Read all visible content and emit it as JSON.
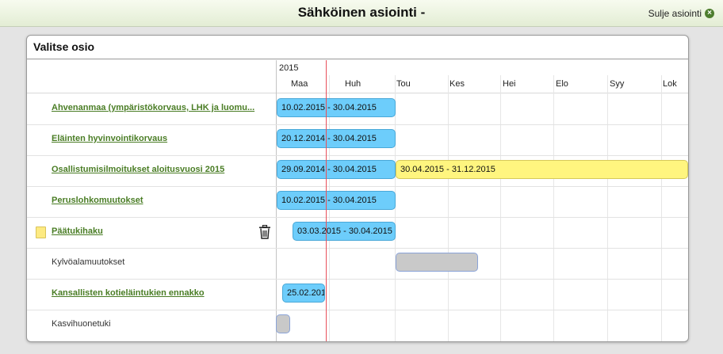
{
  "header": {
    "title": "Sähköinen asiointi  -",
    "close_label": "Sulje asiointi",
    "close_icon": "close-circle-icon"
  },
  "panel": {
    "title": "Valitse osio"
  },
  "timeline": {
    "year": "2015",
    "months": [
      "Maa",
      "Huh",
      "Tou",
      "Kes",
      "Hei",
      "Elo",
      "Syy",
      "Lok"
    ],
    "today_marker_color": "#e8505a"
  },
  "rows": [
    {
      "label": "Ahvenanmaa (ympäristökorvaus, LHK ja luomu...",
      "link": true,
      "bars": [
        {
          "text": "10.02.2015 - 30.04.2015",
          "color": "blue"
        }
      ]
    },
    {
      "label": "Eläinten hyvinvointikorvaus",
      "link": true,
      "bars": [
        {
          "text": "20.12.2014 - 30.04.2015",
          "color": "blue"
        }
      ]
    },
    {
      "label": "Osallistumisilmoitukset aloitusvuosi 2015",
      "link": true,
      "bars": [
        {
          "text": "29.09.2014 - 30.04.2015",
          "color": "blue"
        },
        {
          "text": "30.04.2015 - 31.12.2015",
          "color": "yellow"
        }
      ]
    },
    {
      "label": "Peruslohkomuutokset",
      "link": true,
      "bars": [
        {
          "text": "10.02.2015 - 30.04.2015",
          "color": "blue"
        }
      ]
    },
    {
      "label": "Päätukihaku",
      "link": true,
      "folder_icon": true,
      "trash_icon": true,
      "bars": [
        {
          "text": "03.03.2015 - 30.04.2015",
          "color": "blue"
        }
      ]
    },
    {
      "label": "Kylvöalamuutokset",
      "link": false,
      "bars": [
        {
          "text": "",
          "color": "gray"
        }
      ]
    },
    {
      "label": "Kansallisten kotieläintukien ennakko",
      "link": true,
      "bars": [
        {
          "text": "25.02.201",
          "color": "blue"
        }
      ]
    },
    {
      "label": "Kasvihuonetuki",
      "link": false,
      "bars": [
        {
          "text": "",
          "color": "gray"
        }
      ]
    }
  ]
}
